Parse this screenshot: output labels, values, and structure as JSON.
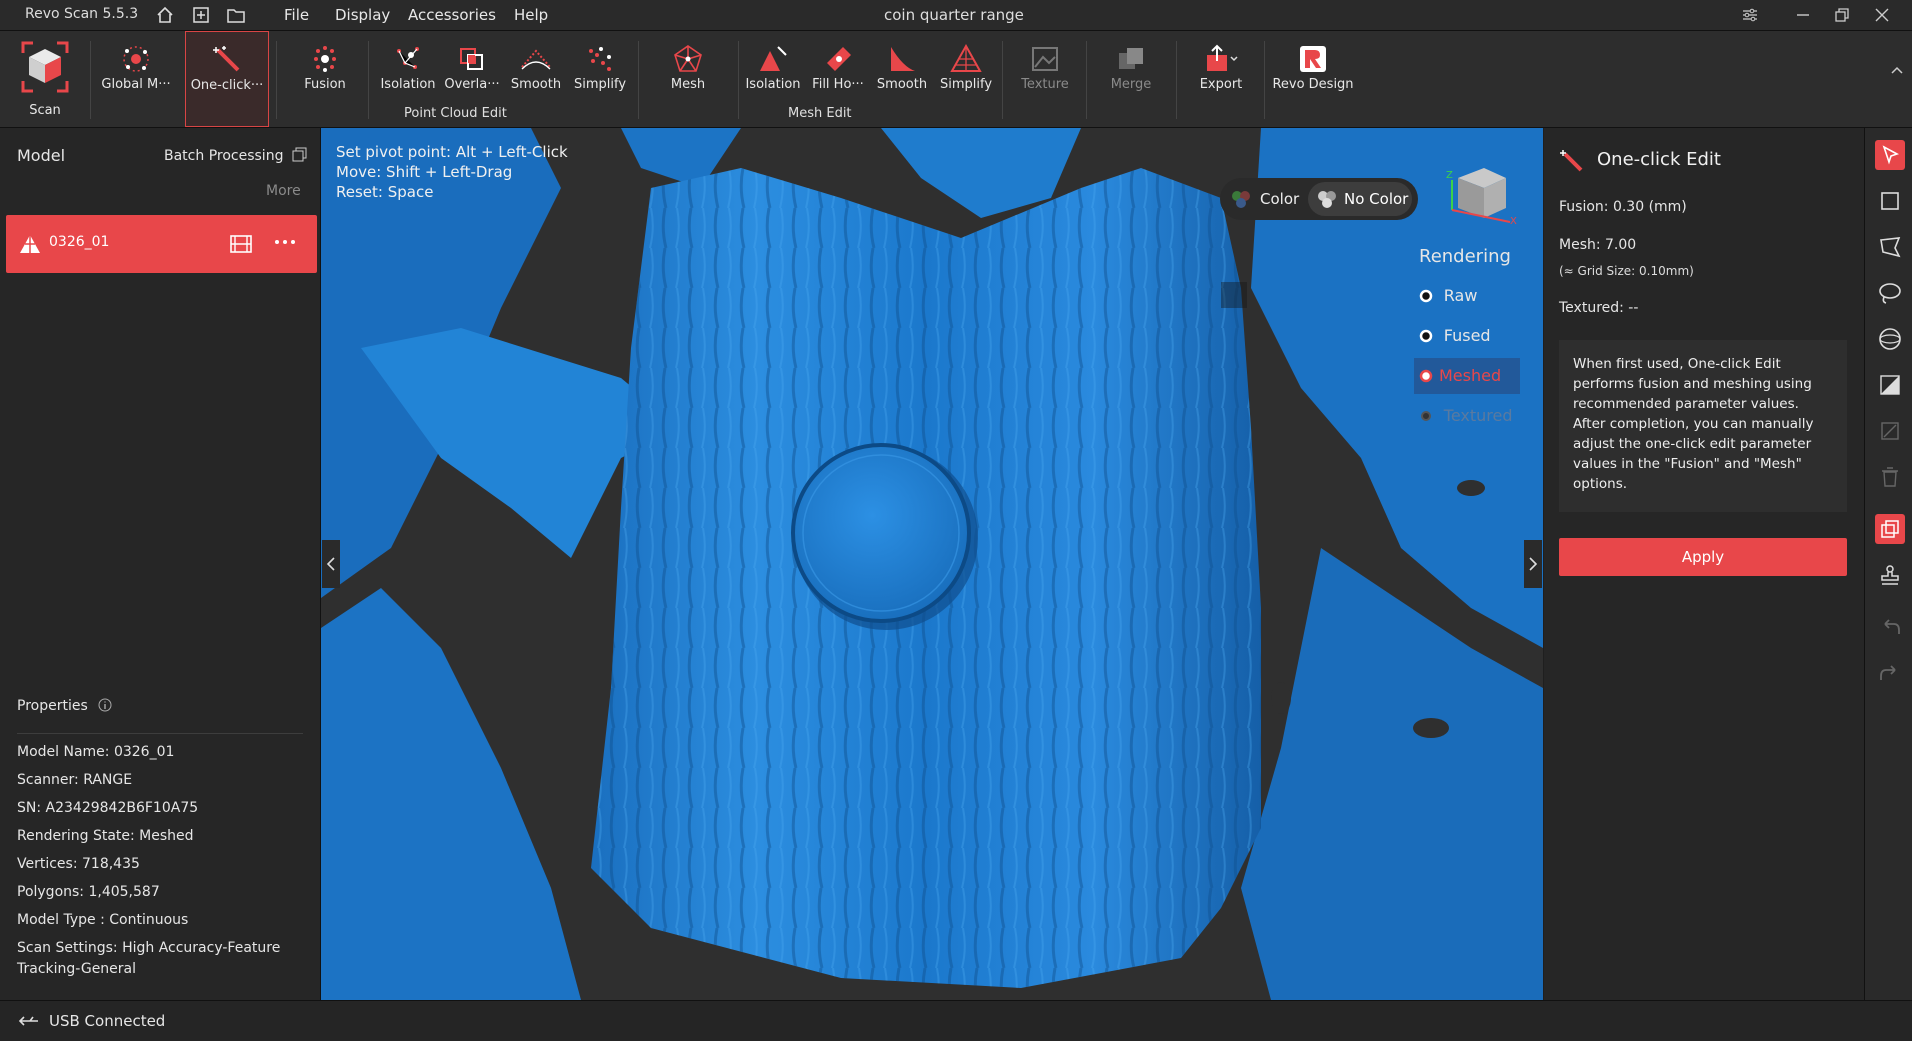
{
  "app": {
    "title": "Revo Scan 5.5.3",
    "document_title": "coin  quarter range"
  },
  "menu": [
    "File",
    "Display",
    "Accessories",
    "Help"
  ],
  "toolbar": {
    "scan": "Scan",
    "global_marker": "Global M···",
    "one_click": "One-click···",
    "fusion": "Fusion",
    "pc_isolation": "Isolation",
    "overlap": "Overla···",
    "pc_smooth": "Smooth",
    "pc_simplify": "Simplify",
    "point_cloud_edit": "Point Cloud Edit",
    "mesh": "Mesh",
    "mesh_isolation": "Isolation",
    "fill_holes": "Fill Ho···",
    "mesh_smooth": "Smooth",
    "mesh_simplify": "Simplify",
    "mesh_edit": "Mesh Edit",
    "texture": "Texture",
    "merge": "Merge",
    "export": "Export",
    "revo_design": "Revo Design"
  },
  "left": {
    "model_header": "Model",
    "batch_processing": "Batch Processing",
    "more": "More",
    "model_item": "0326_01",
    "properties_header": "Properties",
    "props": [
      "Model Name:  0326_01",
      "Scanner:  RANGE",
      "SN:  A23429842B6F10A75",
      "Rendering State:  Meshed",
      "Vertices:  718,435",
      "Polygons:  1,405,587",
      "Model Type :  Continuous",
      "Scan Settings:  High Accuracy-Feature",
      "Tracking-General"
    ]
  },
  "viewport": {
    "hint1_label": "Set pivot point: ",
    "hint1_value": "Alt + Left-Click",
    "hint2_label": "Move: ",
    "hint2_value": "Shift + Left-Drag",
    "hint3_label": "Reset: ",
    "hint3_value": "Space",
    "color": "Color",
    "no_color": "No Color",
    "rendering": "Rendering",
    "raw": "Raw",
    "fused": "Fused",
    "meshed": "Meshed",
    "textured": "Textured"
  },
  "right": {
    "title": "One-click Edit",
    "fusion": "Fusion:  0.30 (mm)",
    "mesh": "Mesh:  7.00",
    "grid": "(≈ Grid Size: 0.10mm)",
    "textured": "Textured: --",
    "info": "When first used, One-click Edit performs fusion and meshing using recommended parameter values. After completion, you can manually adjust the one-click edit parameter values in the \"Fusion\" and \"Mesh\" options.",
    "apply": "Apply"
  },
  "status": {
    "usb": "USB Connected"
  },
  "colors": {
    "accent": "#e8474a",
    "mesh": "#1e7fd0"
  }
}
